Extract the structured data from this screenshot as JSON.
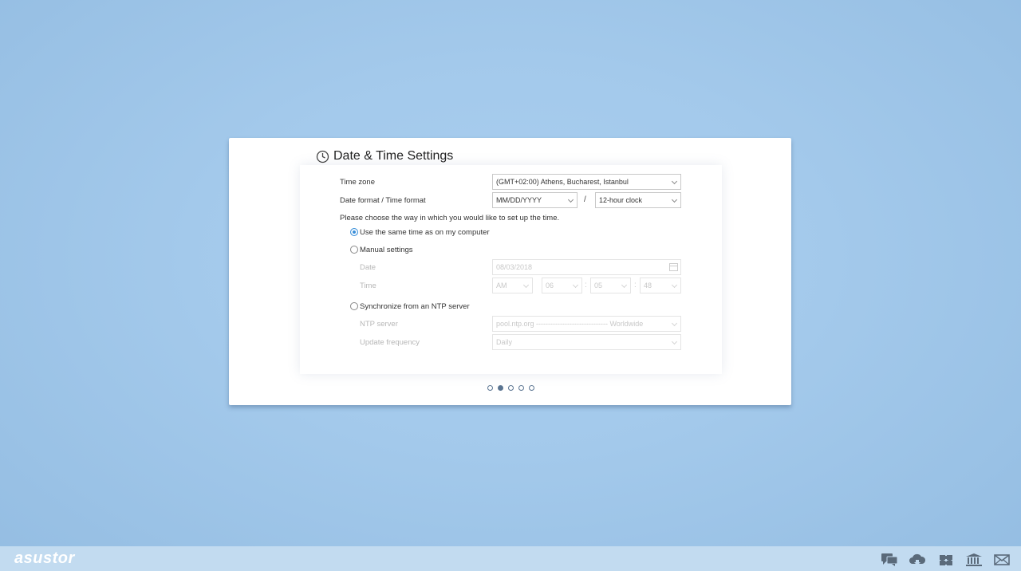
{
  "dialog": {
    "title": "Date & Time Settings",
    "timezone": {
      "label": "Time zone",
      "value": "(GMT+02:00) Athens, Bucharest, Istanbul"
    },
    "format": {
      "label": "Date format / Time format",
      "date_value": "MM/DD/YYYY",
      "separator": "/",
      "time_value": "12-hour clock"
    },
    "instruction": "Please choose the way in which you would like to set up the time.",
    "options": {
      "computer": {
        "label": "Use the same time as on my computer",
        "selected": true
      },
      "manual": {
        "label": "Manual settings",
        "selected": false
      },
      "ntp": {
        "label": "Synchronize from an NTP server",
        "selected": false
      }
    },
    "manual": {
      "date_label": "Date",
      "date_value": "08/03/2018",
      "time_label": "Time",
      "ampm": "AM",
      "hour": "06",
      "minute": "05",
      "second": "48",
      "colon": ":"
    },
    "ntp": {
      "server_label": "NTP server",
      "server_value": "pool.ntp.org ------------------------------ Worldwide",
      "frequency_label": "Update frequency",
      "frequency_value": "Daily"
    },
    "pagination": {
      "total": 5,
      "active": 2
    }
  },
  "taskbar": {
    "logo": "asustor",
    "icons": [
      "chat-icon",
      "cloud-download-icon",
      "puzzle-icon",
      "bank-icon",
      "mail-icon"
    ]
  },
  "colors": {
    "accent": "#3a8fd9",
    "arrow": "#5a7491"
  }
}
